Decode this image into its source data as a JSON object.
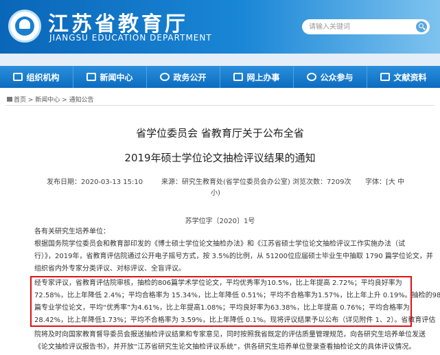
{
  "header": {
    "title": "江苏省教育厅",
    "subtitle": "JIANGSU EDUCATION DEPARTMENT",
    "search_placeholder": "请输入关键词"
  },
  "nav": {
    "items": [
      {
        "label": "组织机构",
        "icon": "org-icon"
      },
      {
        "label": "新闻中心",
        "icon": "news-icon"
      },
      {
        "label": "政务公开",
        "icon": "gov-icon"
      },
      {
        "label": "网上办事",
        "icon": "online-icon"
      },
      {
        "label": "公众参与",
        "icon": "public-icon"
      },
      {
        "label": "文献资料",
        "icon": "docs-icon"
      }
    ]
  },
  "breadcrumb": {
    "home": "首页",
    "sep1": " > ",
    "news": "新闻中心",
    "sep2": " > ",
    "current": "通知公告"
  },
  "article": {
    "title_line1": "省学位委员会 省教育厅关于公布全省",
    "title_line2": "2019年硕士学位论文抽检评议结果的通知",
    "publish_date": "发布日期：2020-03-13 15:10",
    "source_line1": "来源：研究生教育处(省学位委员会办公室)",
    "source_line2": "小)",
    "views": "浏览次数：7209次",
    "font_line1": "字体：[大 中",
    "doc_number": "苏学位字〔2020〕1号",
    "lines": [
      "各有关研究生培养单位：",
      "    根据国务院学位委员会和教育部印发的《博士硕士学位论文抽检办法》和《江苏省硕士学位论文抽检评议工作实施办法（试",
      "行）》，2019年，省教育评估院通过公开电子摇号方式，按 3.5%的比例，从 51200位应届硕士毕业生中抽取 1790 篇学位论文，并",
      "组织省内外专家分类评议、对标评议、全盲评议。",
      "    经专家评议，省教育评估院审核，抽检的806篇学术学位论文，平均优秀率为10.5%，比上年提高 2.72%；平均良好率为",
      "72.58%，比上年降低 2.4%；平均合格率为 15.34%，比上年降低 0.51%；平均不合格率为1.57%，比上年上升 0.19%。抽检的984",
      "篇专业学位论文，平均“优秀率”为4.61%，比上年提高1.08%；平均良好率为63.38%，比上年提高 0.76%；平均合格率为",
      "28.42%，比上年降低1.73%；平均不合格率为 3.59%，比上年降低 0.1%。现将评议结果予以公布（详见附件 1、2）。省教育评估",
      "院将及时向国家教育督导委员会报送抽检评议结果和专家意见，同时按照我省既定的评估质量管理规范，向各研究生培养单位发送",
      "《论文抽检评议报告书》，并开放“江苏省研究生论文抽检评议系统”，供各研究生培养单位登录查看抽检论文的具体评议情况。"
    ]
  }
}
